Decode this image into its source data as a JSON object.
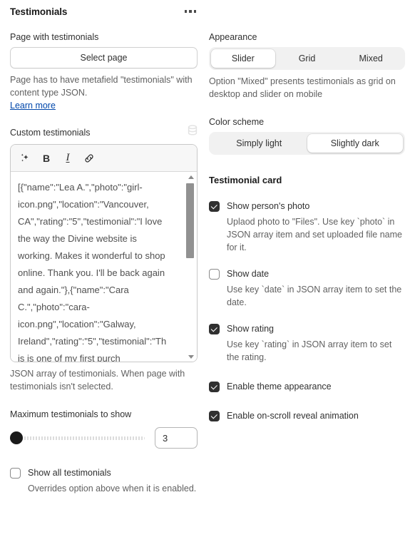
{
  "header": {
    "title": "Testimonials",
    "menu_icon": "kebab-menu-icon"
  },
  "left": {
    "page_field_label": "Page with testimonials",
    "select_page_button": "Select page",
    "page_help_text": "Page has to have metafield \"testimonials\" with content type JSON.",
    "learn_more_link": "Learn more",
    "custom_label": "Custom testimonials",
    "metafield_icon": "database-icon",
    "toolbar": {
      "magic_icon": "sparkle-magic-icon",
      "bold_label": "B",
      "italic_label": "I",
      "link_icon": "link-icon"
    },
    "textarea_value": "[{\"name\":\"Lea A.\",\"photo\":\"girl-icon.png\",\"location\":\"Vancouver, CA\",\"rating\":\"5\",\"testimonial\":\"I love the way the Divine website is working. Makes it wonderful to shop online. Thank you. I'll be back again and again.\"},{\"name\":\"Cara C.\",\"photo\":\"cara-icon.png\",\"location\":\"Galway, Ireland\",\"rating\":\"5\",\"testimonial\":\"This is one of my first purch",
    "textarea_help": "JSON array of testimonials. When page with testimonials isn't selected.",
    "max_label": "Maximum testimonials to show",
    "max_value": "3",
    "show_all_label": "Show all testimonials",
    "show_all_checked": false,
    "show_all_desc": "Overrides option above when it is enabled."
  },
  "right": {
    "appearance_label": "Appearance",
    "appearance_options": [
      "Slider",
      "Grid",
      "Mixed"
    ],
    "appearance_selected": "Slider",
    "appearance_help": "Option \"Mixed\" presents testimonials as grid on desktop and slider on mobile",
    "color_scheme_label": "Color scheme",
    "color_scheme_options": [
      "Simply light",
      "Slightly dark"
    ],
    "color_scheme_selected": "Slightly dark",
    "card_section_title": "Testimonial card",
    "checks": [
      {
        "label": "Show person's photo",
        "checked": true,
        "desc": "Uplaod photo to \"Files\". Use key `photo` in JSON array item and set uploaded file name for it."
      },
      {
        "label": "Show date",
        "checked": false,
        "desc": "Use key `date` in JSON array item to set the date."
      },
      {
        "label": "Show rating",
        "checked": true,
        "desc": "Use key `rating` in JSON array item to set the rating."
      },
      {
        "label": "Enable theme appearance",
        "checked": true,
        "desc": ""
      },
      {
        "label": "Enable on-scroll reveal animation",
        "checked": true,
        "desc": ""
      }
    ]
  },
  "colors": {
    "text_primary": "#303030",
    "text_secondary": "#616161",
    "link": "#0047ab",
    "accent_dark": "#303030",
    "segment_bg": "#f1f1f1"
  }
}
